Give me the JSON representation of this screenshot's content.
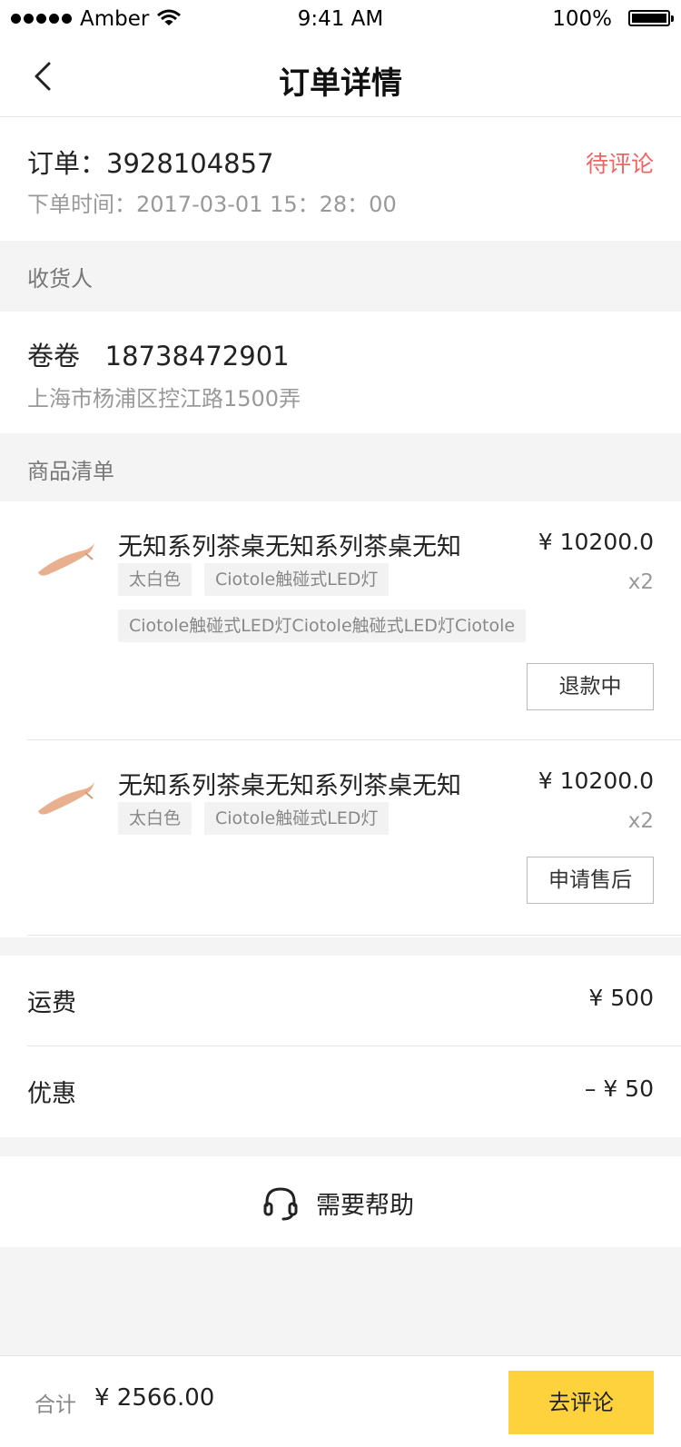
{
  "status_bar": {
    "carrier": "Amber",
    "time": "9:41 AM",
    "battery": "100%"
  },
  "nav": {
    "title": "订单详情"
  },
  "order": {
    "number": "订单：3928104857",
    "status": "待评论",
    "time": "下单时间：2017-03-01 15：28：00"
  },
  "receiver": {
    "section_label": "收货人",
    "name_phone": "卷卷   18738472901",
    "address": "上海市杨浦区控江路1500弄"
  },
  "goods": {
    "section_label": "商品清单",
    "items": [
      {
        "name": "无知系列茶桌无知系列茶桌无知",
        "price": "¥ 10200.0",
        "qty": "x2",
        "tags": [
          "太白色",
          "Ciotole触碰式LED灯"
        ],
        "tag2": "Ciotole触碰式LED灯Ciotole触碰式LED灯Ciotole",
        "action": "退款中"
      },
      {
        "name": "无知系列茶桌无知系列茶桌无知",
        "price": "¥ 10200.0",
        "qty": "x2",
        "tags": [
          "太白色",
          "Ciotole触碰式LED灯"
        ],
        "action": "申请售后"
      }
    ]
  },
  "fees": {
    "shipping_label": "运费",
    "shipping_value": "¥ 500",
    "discount_label": "优惠",
    "discount_value": "– ¥ 50"
  },
  "help": {
    "label": "需要帮助",
    "icon": "headset-icon"
  },
  "footer": {
    "total_label": "合计",
    "total_value": "¥ 2566.00",
    "cta": "去评论"
  },
  "colors": {
    "accent": "#fdd23d",
    "status_red": "#f06464"
  }
}
